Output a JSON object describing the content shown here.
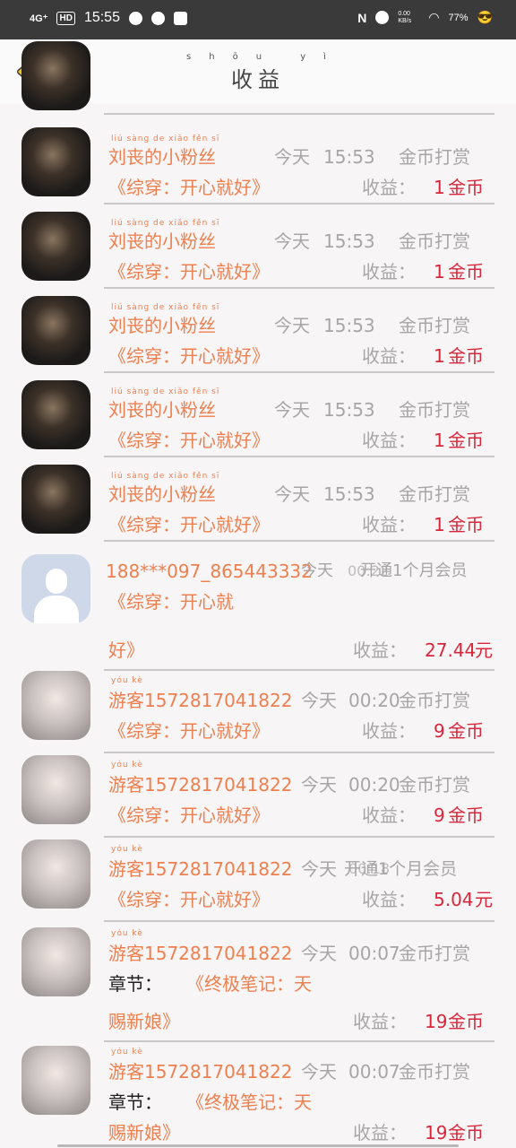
{
  "status": {
    "network": "4G⁺",
    "hd": "HD",
    "time": "15:55",
    "net_speed": "0.00 KB/s",
    "battery": "77%"
  },
  "header": {
    "title": "收益",
    "title_pinyin": "shōu yì"
  },
  "labels": {
    "income": "收益：",
    "tip": "金币打赏",
    "coin_unit": "金币",
    "yuan": "元"
  },
  "rows": [
    {
      "name": "刘丧的小粉丝",
      "date": "今天",
      "time": "15:53",
      "book": "《综穿：开心就好》",
      "type": "金币打赏",
      "amount": "1"
    },
    {
      "name": "刘丧的小粉丝",
      "date": "今天",
      "time": "15:53",
      "book": "《综穿：开心就好》",
      "type": "金币打赏",
      "amount": "1"
    },
    {
      "name": "刘丧的小粉丝",
      "date": "今天",
      "time": "15:53",
      "book": "《综穿：开心就好》",
      "type": "金币打赏",
      "amount": "1"
    },
    {
      "name": "刘丧的小粉丝",
      "date": "今天",
      "time": "15:53",
      "book": "《综穿：开心就好》",
      "type": "金币打赏",
      "amount": "1"
    },
    {
      "name": "刘丧的小粉丝",
      "date": "今天",
      "time": "15:53",
      "book": "《综穿：开心就好》",
      "type": "金币打赏",
      "amount": "1"
    },
    {
      "name": "188***097_865443332",
      "date": "今天",
      "time": "00:22",
      "book_l1": "《综穿：开心就",
      "book_l2": "好》",
      "type": "开通1个月会员",
      "amount": "27.44"
    },
    {
      "name": "游客1572817041822",
      "date": "今天",
      "time": "00:20",
      "book": "《综穿：开心就好》",
      "type": "金币打赏",
      "amount": "9"
    },
    {
      "name": "游客1572817041822",
      "date": "今天",
      "time": "00:20",
      "book": "《综穿：开心就好》",
      "type": "金币打赏",
      "amount": "9"
    },
    {
      "name": "游客1572817041822",
      "date": "今天",
      "time": "00:18",
      "book": "《综穿：开心就好》",
      "type": "开通1个月会员",
      "amount": "5.04"
    },
    {
      "name": "游客1572817041822",
      "date": "今天",
      "time": "00:07",
      "chapter": "章节：",
      "book_l1": "《终极笔记：天",
      "book_l2": "赐新娘》",
      "type": "金币打赏",
      "amount": "19"
    },
    {
      "name": "游客1572817041822",
      "date": "今天",
      "time": "00:07",
      "chapter": "章节：",
      "book_l1": "《终极笔记：天",
      "book_l2": "赐新娘》",
      "type": "金币打赏",
      "amount": "19"
    }
  ]
}
